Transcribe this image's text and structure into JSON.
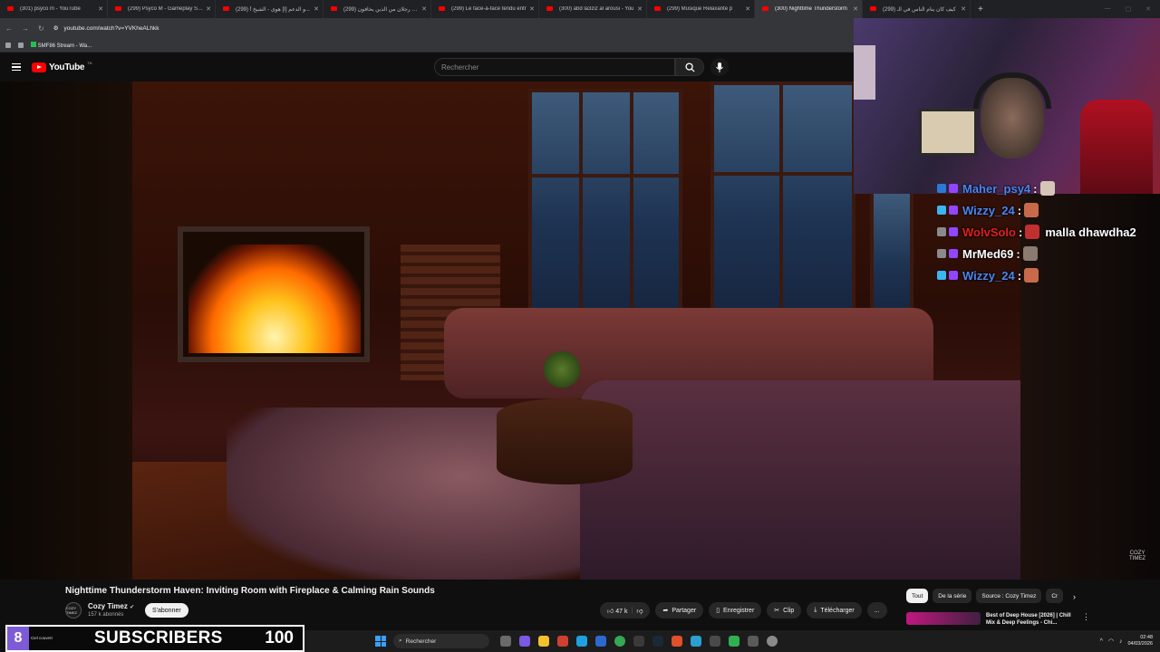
{
  "browser": {
    "tabs": [
      {
        "title": "(301) psyco m - YouTube",
        "active": false
      },
      {
        "title": "(299) Psyco M - Gameplay Stre",
        "active": false
      },
      {
        "title": "(299) و الدعم [ا] هوى - الشيخ أ...",
        "active": false
      },
      {
        "title": "(299) قال رجلان من الذين يخافون...",
        "active": false
      },
      {
        "title": "(299) Le face-à-face tendu entr",
        "active": false
      },
      {
        "title": "(300) abd la3ziz al arousi - You",
        "active": false
      },
      {
        "title": "(299) Musique Relaxante p",
        "active": false
      },
      {
        "title": "(300) Nighttime Thunderstorm",
        "active": true
      },
      {
        "title": "(299) كيف كان ينام الناس في الـ",
        "active": false
      }
    ],
    "new_tab": "+",
    "url": "youtube.com/watch?v=YVKheALhkk",
    "bookmark": "SMF86 Stream - Wa..."
  },
  "youtube": {
    "logo_text": "YouTube",
    "logo_region": "TN",
    "search_placeholder": "Rechercher"
  },
  "video": {
    "watermark_line1": "COZY",
    "watermark_line2": "TIMEZ",
    "title": "Nighttime Thunderstorm Haven: Inviting Room with Fireplace & Calming Rain Sounds",
    "channel": {
      "avatar_text": "COZY TIMEZ",
      "name": "Cozy Timez",
      "subscribers": "157 k abonnés",
      "subscribe_label": "S'abonner"
    },
    "actions": {
      "likes": "47 k",
      "share": "Partager",
      "save": "Enregistrer",
      "clip": "Clip",
      "download": "Télécharger",
      "more": "..."
    }
  },
  "sidebar": {
    "chips": [
      "Tout",
      "De la série",
      "Source : Cozy Timez",
      "Cr"
    ],
    "reco_title": "Best of Deep House [2026] | Chill Mix & Deep Feelings - Chi..."
  },
  "stream_chat": [
    {
      "user": "Maher_psy4",
      "color": "#4a86f0",
      "message": "",
      "emote_color": "#d6c6b6"
    },
    {
      "user": "Wizzy_24",
      "color": "#4a86f0",
      "message": "",
      "emote_color": "#c86a4a"
    },
    {
      "user": "WolvSolo",
      "color": "#e02020",
      "message": "malla dhawdha2",
      "emote_color": "#c03030"
    },
    {
      "user": "MrMed69",
      "color": "#ffffff",
      "message": "",
      "emote_color": "#8a7a70"
    },
    {
      "user": "Wizzy_24",
      "color": "#4a86f0",
      "message": "",
      "emote_color": "#c86a4a"
    }
  ],
  "subscribers_overlay": {
    "weather_temp": "8",
    "weather_text": "Ciel couvert",
    "label": "SUBSCRIBERS",
    "goal": "100"
  },
  "taskbar": {
    "search_label": "Rechercher",
    "time": "02:48",
    "date": "04/03/2026"
  },
  "colors": {
    "yt_red": "#ff0000",
    "accent_purple": "#7e5bd6",
    "win_blue": "#3aa0ff"
  }
}
